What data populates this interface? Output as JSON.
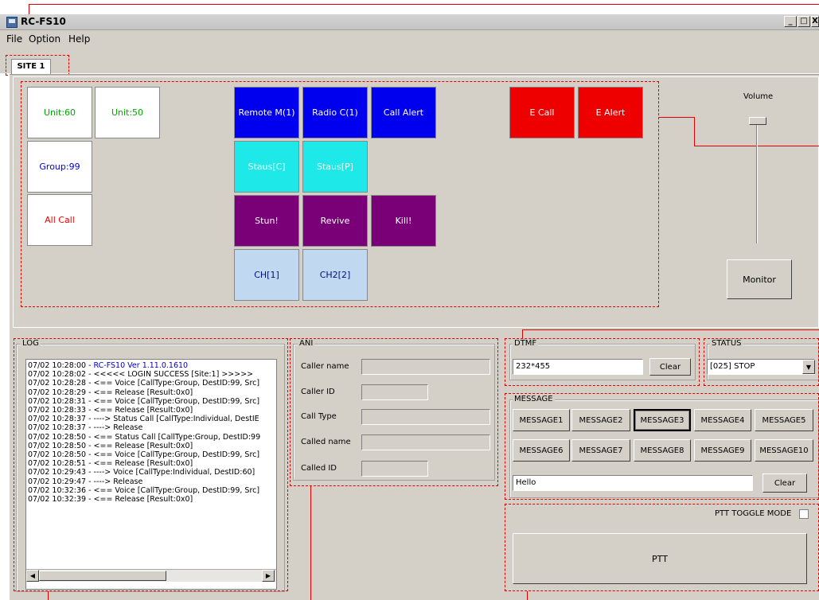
{
  "window": {
    "title": "RC-FS10",
    "min_label": "_",
    "max_label": "□",
    "close_label": "X"
  },
  "menu": [
    {
      "label": "File"
    },
    {
      "label": "Option"
    },
    {
      "label": "Help"
    }
  ],
  "tabs": [
    {
      "label": "SITE 1"
    }
  ],
  "targets": [
    {
      "label": "Unit:60",
      "color": "#00aa00"
    },
    {
      "label": "Unit:50",
      "color": "#00aa00"
    },
    {
      "label": "Group:99",
      "color": "#0000dd"
    },
    {
      "label": "All Call",
      "color": "#ee0000"
    }
  ],
  "functions": {
    "remote": "Remote M(1)",
    "radio_check": "Radio C(1)",
    "call_alert": "Call Alert",
    "status_c": "Staus[C]",
    "status_p": "Staus[P]",
    "stun": "Stun!",
    "revive": "Revive",
    "kill": "Kill!",
    "ch1": "CH[1]",
    "ch2": "CH2[2]",
    "e_call": "E Call",
    "e_alert": "E Alert"
  },
  "volume": {
    "label": "Volume",
    "level": 0.0
  },
  "monitor_label": "Monitor",
  "log": {
    "label": "LOG",
    "lines": [
      {
        "time": "07/02 10:28:00 - ",
        "text": "RC-FS10 Ver 1.11.0.1610",
        "highlight": true
      },
      {
        "time": "07/02 10:28:02 - ",
        "text": "<<<<< LOGIN SUCCESS [Site:1] >>>>>"
      },
      {
        "time": "07/02 10:28:28 - ",
        "text": "<== Voice [CallType:Group, DestID:99, Src]"
      },
      {
        "time": "07/02 10:28:29 - ",
        "text": "<== Release [Result:0x0]"
      },
      {
        "time": "07/02 10:28:31 - ",
        "text": "<== Voice [CallType:Group, DestID:99, Src]"
      },
      {
        "time": "07/02 10:28:33 - ",
        "text": "<== Release [Result:0x0]"
      },
      {
        "time": "07/02 10:28:37 - ",
        "text": "----> Status Call [CallType:Individual, DestIE"
      },
      {
        "time": "07/02 10:28:37 - ",
        "text": "----> Release"
      },
      {
        "time": "07/02 10:28:50 - ",
        "text": "<== Status Call [CallType:Group, DestID:99"
      },
      {
        "time": "07/02 10:28:50 - ",
        "text": "<== Release [Result:0x0]"
      },
      {
        "time": "07/02 10:28:50 - ",
        "text": "<== Voice [CallType:Group, DestID:99, Src]"
      },
      {
        "time": "07/02 10:28:51 - ",
        "text": "<== Release [Result:0x0]"
      },
      {
        "time": "07/02 10:29:43 - ",
        "text": "----> Voice [CallType:Individual, DestID:60]"
      },
      {
        "time": "07/02 10:29:47 - ",
        "text": "----> Release"
      },
      {
        "time": "07/02 10:32:36 - ",
        "text": "<== Voice [CallType:Group, DestID:99, Src]"
      },
      {
        "time": "07/02 10:32:39 - ",
        "text": "<== Release [Result:0x0]"
      }
    ]
  },
  "ani": {
    "label": "ANI",
    "caller_name_label": "Caller name",
    "caller_name_value": "",
    "caller_id_label": "Caller ID",
    "caller_id_value": "",
    "call_type_label": "Call Type",
    "call_type_value": "",
    "called_name_label": "Called name",
    "called_name_value": "",
    "called_id_label": "Called ID",
    "called_id_value": ""
  },
  "dtmf": {
    "label": "DTMF",
    "value": "232*455",
    "clear_label": "Clear"
  },
  "status": {
    "label": "STATUS",
    "selected": "[025] STOP"
  },
  "message": {
    "label": "MESSAGE",
    "buttons": [
      "MESSAGE1",
      "MESSAGE2",
      "MESSAGE3",
      "MESSAGE4",
      "MESSAGE5",
      "MESSAGE6",
      "MESSAGE7",
      "MESSAGE8",
      "MESSAGE9",
      "MESSAGE10"
    ],
    "selected": "MESSAGE3",
    "text": "Hello",
    "clear_label": "Clear"
  },
  "ptt": {
    "toggle_label": "PTT TOGGLE MODE",
    "toggle_checked": false,
    "button_label": "PTT"
  }
}
